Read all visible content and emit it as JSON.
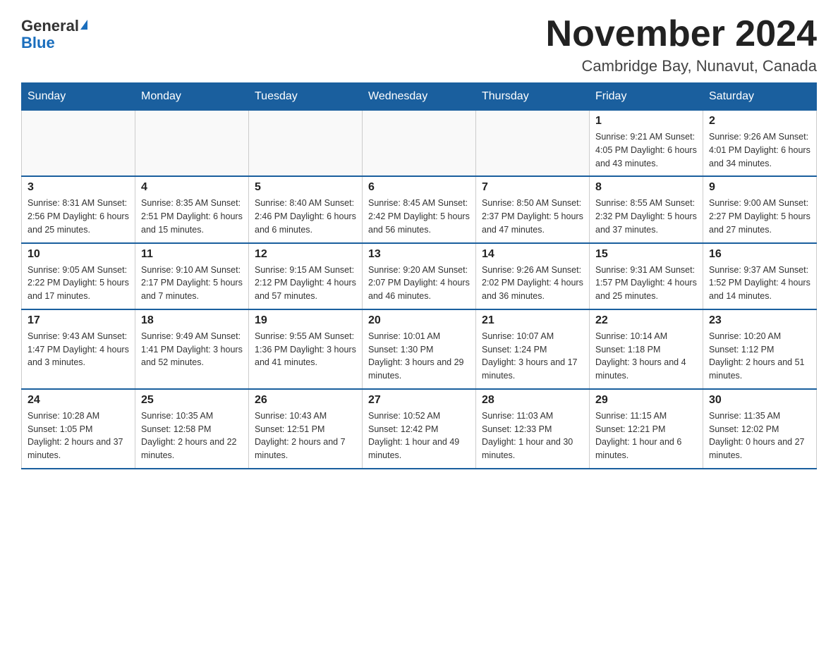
{
  "logo": {
    "line1": "General",
    "line2": "Blue"
  },
  "title": "November 2024",
  "subtitle": "Cambridge Bay, Nunavut, Canada",
  "days_of_week": [
    "Sunday",
    "Monday",
    "Tuesday",
    "Wednesday",
    "Thursday",
    "Friday",
    "Saturday"
  ],
  "weeks": [
    [
      {
        "day": "",
        "info": ""
      },
      {
        "day": "",
        "info": ""
      },
      {
        "day": "",
        "info": ""
      },
      {
        "day": "",
        "info": ""
      },
      {
        "day": "",
        "info": ""
      },
      {
        "day": "1",
        "info": "Sunrise: 9:21 AM\nSunset: 4:05 PM\nDaylight: 6 hours and 43 minutes."
      },
      {
        "day": "2",
        "info": "Sunrise: 9:26 AM\nSunset: 4:01 PM\nDaylight: 6 hours and 34 minutes."
      }
    ],
    [
      {
        "day": "3",
        "info": "Sunrise: 8:31 AM\nSunset: 2:56 PM\nDaylight: 6 hours and 25 minutes."
      },
      {
        "day": "4",
        "info": "Sunrise: 8:35 AM\nSunset: 2:51 PM\nDaylight: 6 hours and 15 minutes."
      },
      {
        "day": "5",
        "info": "Sunrise: 8:40 AM\nSunset: 2:46 PM\nDaylight: 6 hours and 6 minutes."
      },
      {
        "day": "6",
        "info": "Sunrise: 8:45 AM\nSunset: 2:42 PM\nDaylight: 5 hours and 56 minutes."
      },
      {
        "day": "7",
        "info": "Sunrise: 8:50 AM\nSunset: 2:37 PM\nDaylight: 5 hours and 47 minutes."
      },
      {
        "day": "8",
        "info": "Sunrise: 8:55 AM\nSunset: 2:32 PM\nDaylight: 5 hours and 37 minutes."
      },
      {
        "day": "9",
        "info": "Sunrise: 9:00 AM\nSunset: 2:27 PM\nDaylight: 5 hours and 27 minutes."
      }
    ],
    [
      {
        "day": "10",
        "info": "Sunrise: 9:05 AM\nSunset: 2:22 PM\nDaylight: 5 hours and 17 minutes."
      },
      {
        "day": "11",
        "info": "Sunrise: 9:10 AM\nSunset: 2:17 PM\nDaylight: 5 hours and 7 minutes."
      },
      {
        "day": "12",
        "info": "Sunrise: 9:15 AM\nSunset: 2:12 PM\nDaylight: 4 hours and 57 minutes."
      },
      {
        "day": "13",
        "info": "Sunrise: 9:20 AM\nSunset: 2:07 PM\nDaylight: 4 hours and 46 minutes."
      },
      {
        "day": "14",
        "info": "Sunrise: 9:26 AM\nSunset: 2:02 PM\nDaylight: 4 hours and 36 minutes."
      },
      {
        "day": "15",
        "info": "Sunrise: 9:31 AM\nSunset: 1:57 PM\nDaylight: 4 hours and 25 minutes."
      },
      {
        "day": "16",
        "info": "Sunrise: 9:37 AM\nSunset: 1:52 PM\nDaylight: 4 hours and 14 minutes."
      }
    ],
    [
      {
        "day": "17",
        "info": "Sunrise: 9:43 AM\nSunset: 1:47 PM\nDaylight: 4 hours and 3 minutes."
      },
      {
        "day": "18",
        "info": "Sunrise: 9:49 AM\nSunset: 1:41 PM\nDaylight: 3 hours and 52 minutes."
      },
      {
        "day": "19",
        "info": "Sunrise: 9:55 AM\nSunset: 1:36 PM\nDaylight: 3 hours and 41 minutes."
      },
      {
        "day": "20",
        "info": "Sunrise: 10:01 AM\nSunset: 1:30 PM\nDaylight: 3 hours and 29 minutes."
      },
      {
        "day": "21",
        "info": "Sunrise: 10:07 AM\nSunset: 1:24 PM\nDaylight: 3 hours and 17 minutes."
      },
      {
        "day": "22",
        "info": "Sunrise: 10:14 AM\nSunset: 1:18 PM\nDaylight: 3 hours and 4 minutes."
      },
      {
        "day": "23",
        "info": "Sunrise: 10:20 AM\nSunset: 1:12 PM\nDaylight: 2 hours and 51 minutes."
      }
    ],
    [
      {
        "day": "24",
        "info": "Sunrise: 10:28 AM\nSunset: 1:05 PM\nDaylight: 2 hours and 37 minutes."
      },
      {
        "day": "25",
        "info": "Sunrise: 10:35 AM\nSunset: 12:58 PM\nDaylight: 2 hours and 22 minutes."
      },
      {
        "day": "26",
        "info": "Sunrise: 10:43 AM\nSunset: 12:51 PM\nDaylight: 2 hours and 7 minutes."
      },
      {
        "day": "27",
        "info": "Sunrise: 10:52 AM\nSunset: 12:42 PM\nDaylight: 1 hour and 49 minutes."
      },
      {
        "day": "28",
        "info": "Sunrise: 11:03 AM\nSunset: 12:33 PM\nDaylight: 1 hour and 30 minutes."
      },
      {
        "day": "29",
        "info": "Sunrise: 11:15 AM\nSunset: 12:21 PM\nDaylight: 1 hour and 6 minutes."
      },
      {
        "day": "30",
        "info": "Sunrise: 11:35 AM\nSunset: 12:02 PM\nDaylight: 0 hours and 27 minutes."
      }
    ]
  ]
}
